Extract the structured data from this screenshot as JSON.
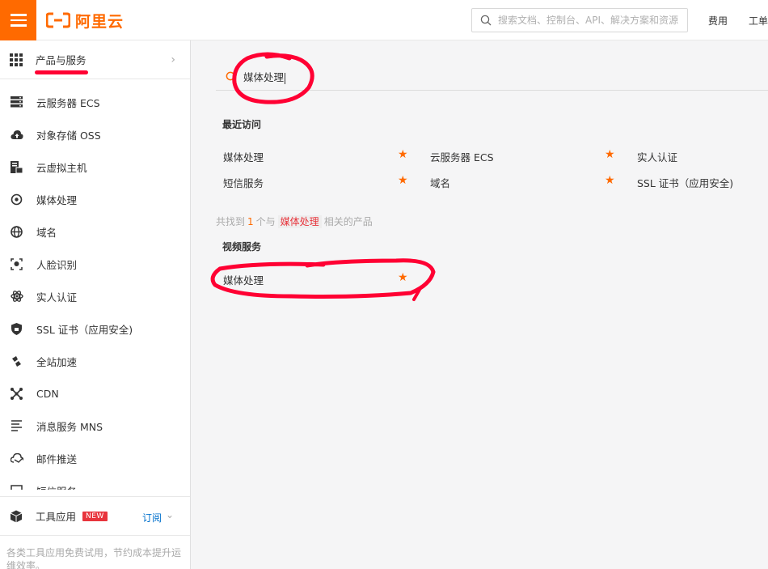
{
  "topbar": {
    "brand": "阿里云",
    "search_placeholder": "搜索文档、控制台、API、解决方案和资源",
    "links": [
      "费用",
      "工单"
    ]
  },
  "sidebar": {
    "header_label": "产品与服务",
    "items": [
      {
        "label": "云服务器 ECS",
        "icon": "server-icon"
      },
      {
        "label": "对象存储 OSS",
        "icon": "cloud-upload-icon"
      },
      {
        "label": "云虚拟主机",
        "icon": "virtual-host-icon"
      },
      {
        "label": "媒体处理",
        "icon": "media-icon"
      },
      {
        "label": "域名",
        "icon": "globe-icon"
      },
      {
        "label": "人脸识别",
        "icon": "face-scan-icon"
      },
      {
        "label": "实人认证",
        "icon": "atom-icon"
      },
      {
        "label": "SSL 证书（应用安全)",
        "icon": "shield-icon"
      },
      {
        "label": "全站加速",
        "icon": "acceleration-icon"
      },
      {
        "label": "CDN",
        "icon": "network-icon"
      },
      {
        "label": "消息服务 MNS",
        "icon": "message-icon"
      },
      {
        "label": "邮件推送",
        "icon": "mail-push-icon"
      },
      {
        "label": "短信服务",
        "icon": "sms-icon"
      }
    ],
    "tools": {
      "label": "工具应用",
      "badge": "NEW",
      "subscribe": "订阅"
    },
    "description": "各类工具应用免费试用，节约成本提升运维效率。"
  },
  "main": {
    "query": "媒体处理",
    "recent_title": "最近访问",
    "recent": [
      [
        "媒体处理",
        "云服务器 ECS",
        "实人认证"
      ],
      [
        "短信服务",
        "域名",
        "SSL 证书（应用安全)"
      ]
    ],
    "found": {
      "prefix": "共找到",
      "count": "1",
      "middle": "个与",
      "keyword": "媒体处理",
      "suffix": "相关的产品"
    },
    "category_title": "视频服务",
    "results": [
      "媒体处理"
    ]
  },
  "colors": {
    "brand_orange": "#ff6a00",
    "annotation_red": "#ff0033",
    "link_blue": "#0070cc"
  }
}
